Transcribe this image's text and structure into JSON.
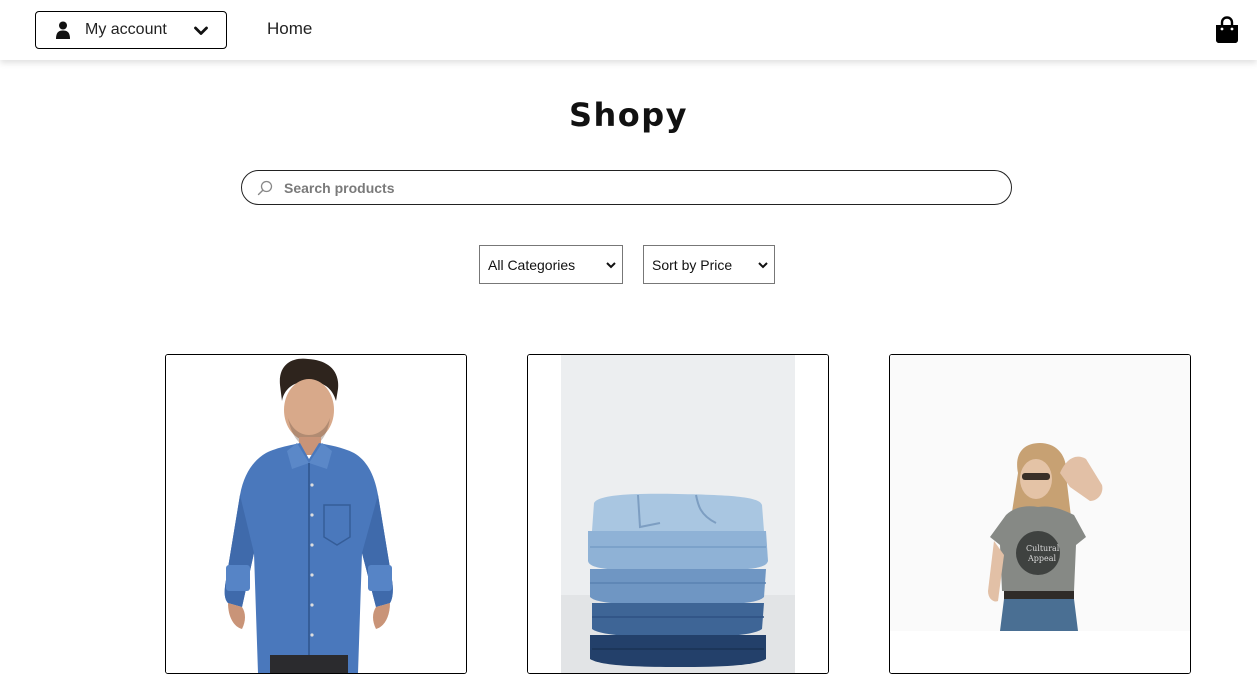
{
  "header": {
    "account_label": "My account",
    "nav_home": "Home",
    "icons": {
      "account": "user-icon",
      "dropdown": "chevron-down-icon",
      "cart": "shopping-bag-icon"
    }
  },
  "brand": {
    "title": "Shopy"
  },
  "search": {
    "placeholder": "Search products",
    "icon": "search-icon"
  },
  "filters": {
    "category": {
      "selected": "All Categories"
    },
    "sort": {
      "selected": "Sort by Price"
    }
  },
  "products": [
    {
      "image": "man-in-blue-denim-shirt"
    },
    {
      "image": "stack-of-folded-jeans"
    },
    {
      "image": "woman-in-grey-graphic-tee"
    }
  ]
}
